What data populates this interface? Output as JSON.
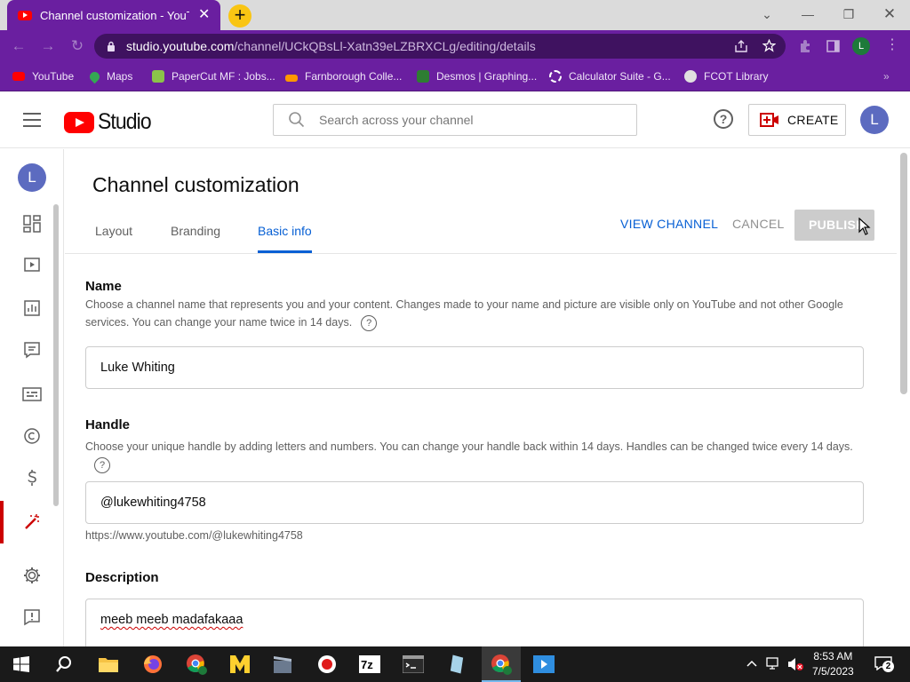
{
  "browser": {
    "tab_title": "Channel customization - YouTube",
    "url_host": "studio.youtube.com",
    "url_path": "/channel/UCkQBsLl-Xatn39eLZBRXCLg/editing/details",
    "profile_initial": "L",
    "bookmarks": [
      {
        "label": "YouTube",
        "color": "#ff0000"
      },
      {
        "label": "Maps",
        "color": "#34a853"
      },
      {
        "label": "PaperCut MF : Jobs...",
        "color": "#8bc34a"
      },
      {
        "label": "Farnborough Colle...",
        "color": "#ff9800"
      },
      {
        "label": "Desmos | Graphing...",
        "color": "#2e7d32"
      },
      {
        "label": "Calculator Suite - G...",
        "color": "#ffffff"
      },
      {
        "label": "FCOT Library",
        "color": "#e0e0e0"
      }
    ]
  },
  "header": {
    "logo_text": "Studio",
    "search_placeholder": "Search across your channel",
    "help_glyph": "?",
    "create_label": "CREATE",
    "avatar_initial": "L"
  },
  "sidebar": {
    "avatar_initial": "L",
    "items": [
      "dashboard",
      "content",
      "analytics",
      "comments",
      "subtitles",
      "copyright",
      "earn",
      "customization",
      "settings",
      "send-feedback"
    ],
    "active_item": "customization"
  },
  "main": {
    "page_title": "Channel customization",
    "tabs": [
      {
        "label": "Layout",
        "active": false
      },
      {
        "label": "Branding",
        "active": false
      },
      {
        "label": "Basic info",
        "active": true
      }
    ],
    "view_channel_label": "VIEW CHANNEL",
    "cancel_label": "CANCEL",
    "publish_label": "PUBLISH",
    "name": {
      "title": "Name",
      "description": "Choose a channel name that represents you and your content. Changes made to your name and picture are visible only on YouTube and not other Google services. You can change your name twice in 14 days.",
      "value": "Luke Whiting"
    },
    "handle": {
      "title": "Handle",
      "description": "Choose your unique handle by adding letters and numbers. You can change your handle back within 14 days. Handles can be changed twice every 14 days.",
      "value": "@lukewhiting4758",
      "url": "https://www.youtube.com/@lukewhiting4758"
    },
    "description_section": {
      "title": "Description",
      "value": "meeb meeb madafakaaa"
    }
  },
  "taskbar": {
    "time": "8:53 AM",
    "date": "7/5/2023",
    "notification_count": "2",
    "apps": [
      "file-explorer",
      "firefox",
      "chrome-profile",
      "miro",
      "clapper",
      "recorder",
      "7zip",
      "terminal",
      "notes",
      "chrome",
      "media"
    ]
  },
  "colors": {
    "browser_accent": "#6a1fa0",
    "link_blue": "#065fd4",
    "youtube_red": "#ff0000"
  }
}
